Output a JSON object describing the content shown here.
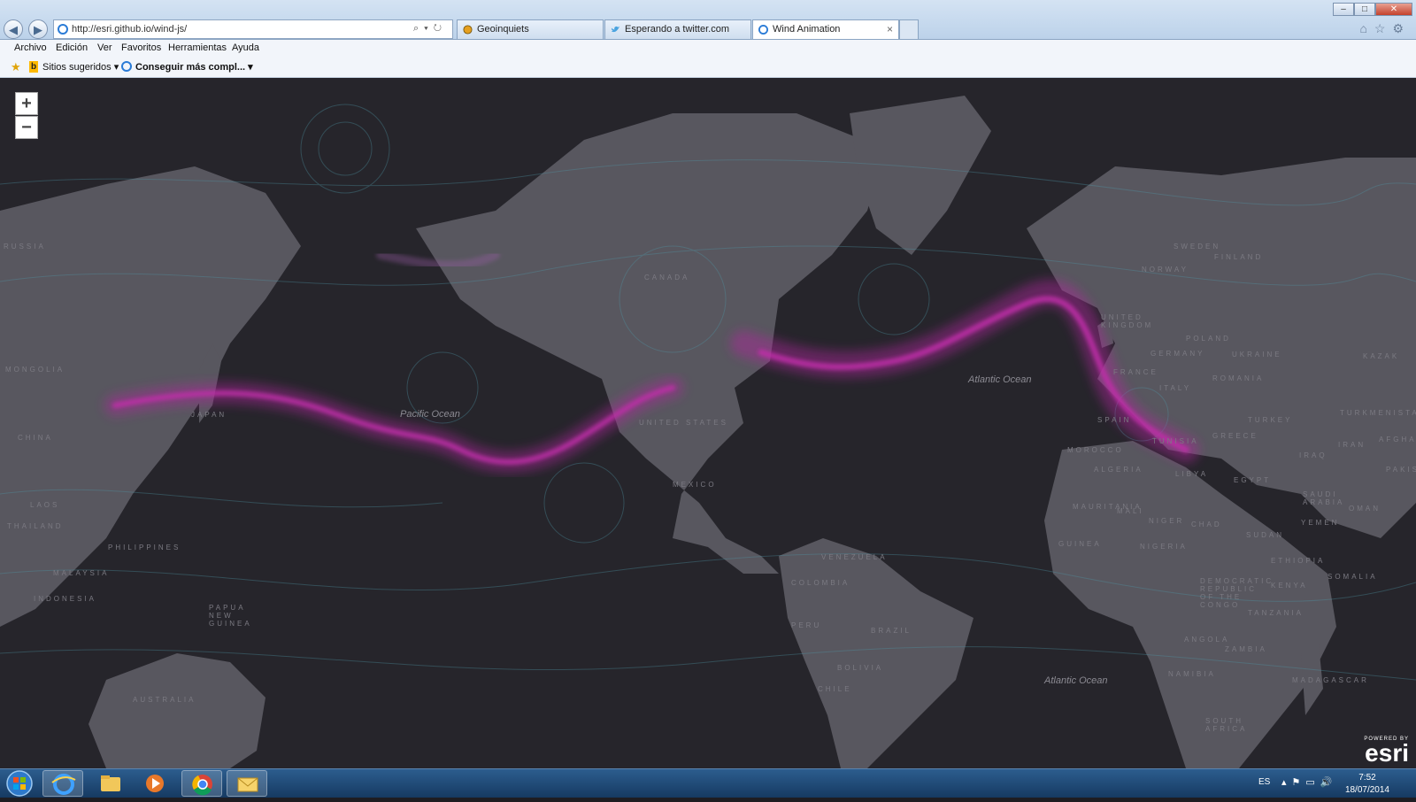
{
  "browser": {
    "address_url": "http://esri.github.io/wind-js/",
    "tabs": [
      {
        "label": "Geoinquiets"
      },
      {
        "label": "Esperando a twitter.com"
      },
      {
        "label": "Wind Animation",
        "close": "×"
      }
    ],
    "window_controls": {
      "minimize": "–",
      "maximize": "□",
      "close": "✕"
    },
    "right_icons": "⌂☆⚙"
  },
  "menubar": {
    "items": [
      "Archivo",
      "Edición",
      "Ver",
      "Favoritos",
      "Herramientas",
      "Ayuda"
    ]
  },
  "favorites": {
    "suggested": "Sitios sugeridos ▾",
    "more": "Conseguir más compl...  ▾"
  },
  "map": {
    "zoom_in": "+",
    "zoom_out": "−",
    "country_labels": [
      {
        "text": "CANADA"
      },
      {
        "text": "UNITED STATES"
      },
      {
        "text": "MEXICO"
      },
      {
        "text": "VENEZUELA"
      },
      {
        "text": "COLOMBIA"
      },
      {
        "text": "PERU"
      },
      {
        "text": "BRAZIL"
      },
      {
        "text": "BOLIVIA"
      },
      {
        "text": "CHILE"
      },
      {
        "text": "UNITED KINGDOM"
      },
      {
        "text": "NORWAY"
      },
      {
        "text": "SWEDEN"
      },
      {
        "text": "FINLAND"
      },
      {
        "text": "POLAND"
      },
      {
        "text": "GERMANY"
      },
      {
        "text": "UKRAINE"
      },
      {
        "text": "FRANCE"
      },
      {
        "text": "ROMANIA"
      },
      {
        "text": "ITALY"
      },
      {
        "text": "SPAIN"
      },
      {
        "text": "TURKEY"
      },
      {
        "text": "GREECE"
      },
      {
        "text": "TUNISIA"
      },
      {
        "text": "MOROCCO"
      },
      {
        "text": "ALGERIA"
      },
      {
        "text": "LIBYA"
      },
      {
        "text": "EGYPT"
      },
      {
        "text": "IRAQ"
      },
      {
        "text": "IRAN"
      },
      {
        "text": "SAUDI ARABIA"
      },
      {
        "text": "YEMEN"
      },
      {
        "text": "OMAN"
      },
      {
        "text": "MAURITANIA"
      },
      {
        "text": "MALI"
      },
      {
        "text": "NIGER"
      },
      {
        "text": "CHAD"
      },
      {
        "text": "SUDAN"
      },
      {
        "text": "ETHIOPIA"
      },
      {
        "text": "SOMALIA"
      },
      {
        "text": "KENYA"
      },
      {
        "text": "GUINEA"
      },
      {
        "text": "NIGERIA"
      },
      {
        "text": "DEMOCRATIC REPUBLIC OF THE CONGO"
      },
      {
        "text": "TANZANIA"
      },
      {
        "text": "ANGOLA"
      },
      {
        "text": "ZAMBIA"
      },
      {
        "text": "NAMIBIA"
      },
      {
        "text": "MADAGASCAR"
      },
      {
        "text": "SOUTH AFRICA"
      },
      {
        "text": "KAZAK"
      },
      {
        "text": "TURKMENISTAN"
      },
      {
        "text": "AFGHANI"
      },
      {
        "text": "PAKIST"
      },
      {
        "text": "RUSSIA"
      },
      {
        "text": "MONGOLIA"
      },
      {
        "text": "CHINA"
      },
      {
        "text": "JAPAN"
      },
      {
        "text": "LAOS"
      },
      {
        "text": "THAILAND"
      },
      {
        "text": "PHILIPPINES"
      },
      {
        "text": "MALAYSIA"
      },
      {
        "text": "INDONESIA"
      },
      {
        "text": "PAPUA NEW GUINEA"
      },
      {
        "text": "AUSTRALIA"
      }
    ],
    "ocean_labels": [
      {
        "text": "Pacific Ocean"
      },
      {
        "text": "Atlantic Ocean"
      },
      {
        "text": "Atlantic Ocean"
      }
    ],
    "attribution_small": "POWERED BY",
    "attribution_logo": "esri",
    "colors": {
      "jet_stream": "#b0279e",
      "flow": "#4f98a8",
      "land": "#5b5a62",
      "ocean": "#26252b"
    }
  },
  "taskbar": {
    "apps": [
      {
        "name": "internet-explorer"
      },
      {
        "name": "file-explorer"
      },
      {
        "name": "media-player"
      },
      {
        "name": "chrome"
      },
      {
        "name": "mail"
      }
    ],
    "language": "ES",
    "tray_icons": "▴⚑▭🔊",
    "time": "7:52",
    "date": "18/07/2014"
  }
}
